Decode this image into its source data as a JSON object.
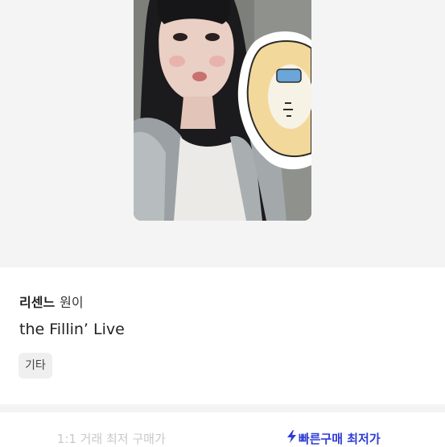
{
  "product": {
    "artist": "리센느",
    "member": "원이",
    "title": "the Fillin’ Live",
    "category": "기타"
  },
  "image": {
    "alt": "photocard",
    "icon": "photocard-image"
  },
  "tabs": [
    {
      "label": "1:1 거래 최저 구매가",
      "active": false
    },
    {
      "label": "빠른구매 최저가",
      "active": true,
      "icon": "lightning-bolt-icon"
    }
  ],
  "colors": {
    "accent": "#2e3bd6",
    "inactive_tab": "#c8c8c8",
    "hero_bg": "#f4f4f4",
    "chip_bg": "#efefef"
  }
}
